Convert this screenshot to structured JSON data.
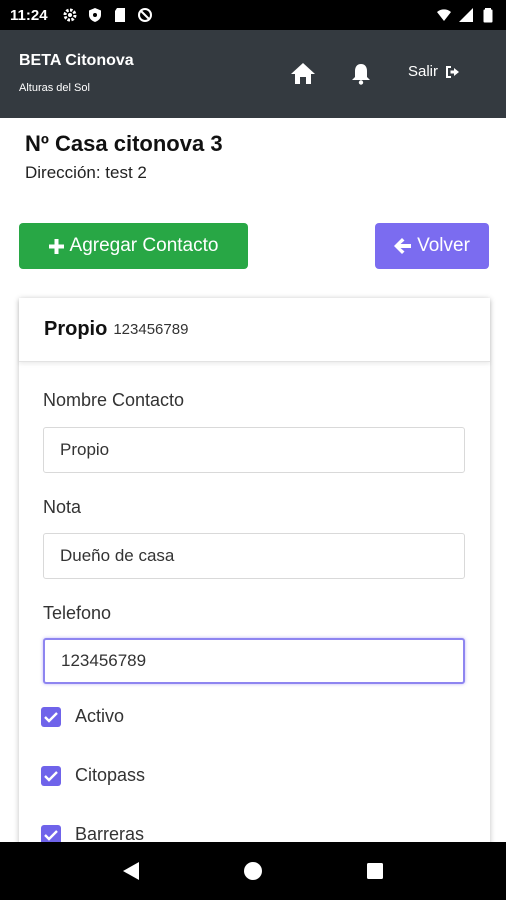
{
  "status_bar": {
    "time": "11:24"
  },
  "app_bar": {
    "brand": "BETA Citonova",
    "subtitle": "Alturas del Sol",
    "logout_label": "Salir"
  },
  "house": {
    "title": "Nº Casa citonova 3",
    "address": "Dirección: test 2"
  },
  "actions": {
    "add_contact": "Agregar Contacto",
    "back": "Volver"
  },
  "contact": {
    "name": "Propio",
    "number": "123456789",
    "fields": {
      "name_label": "Nombre Contacto",
      "name_value": "Propio",
      "note_label": "Nota",
      "note_value": "Dueño de casa",
      "phone_label": "Telefono",
      "phone_value": "123456789"
    },
    "checkboxes": [
      "Activo",
      "Citopass",
      "Barreras"
    ]
  },
  "colors": {
    "appbar": "#343a40",
    "add_button": "#28a745",
    "back_button": "#7b6cf0",
    "checkbox": "#6f63ea"
  }
}
